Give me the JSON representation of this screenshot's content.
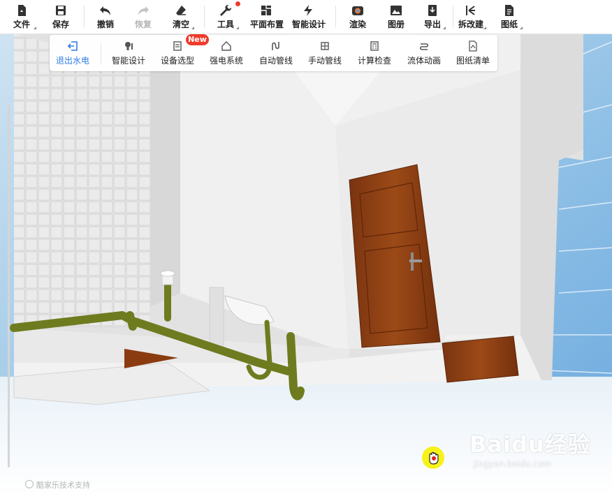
{
  "toolbar": {
    "file": "文件",
    "save": "保存",
    "undo": "撤销",
    "redo": "恢复",
    "clear": "清空",
    "tools": "工具",
    "floor_plan": "平面布置",
    "smart_design": "智能设计",
    "render": "渲染",
    "album": "图册",
    "export": "导出",
    "demolish": "拆改建",
    "drawings": "图纸"
  },
  "subbar": {
    "exit": "退出水电",
    "smart_design": "智能设计",
    "device_select": "设备选型",
    "power_system": "强电系统",
    "auto_pipe": "自动管线",
    "manual_pipe": "手动管线",
    "calc_check": "计算检查",
    "fluid_anim": "流体动画",
    "drawing_list": "图纸清单",
    "new_badge": "New"
  },
  "footer": {
    "support": "酷家乐技术支持"
  },
  "watermark": {
    "brand": "Baidu经验",
    "url": "jingyan.baidu.com"
  },
  "colors": {
    "pipe": "#6f7b1f",
    "door": "#8a3c10",
    "accent": "#2f7ae5",
    "badge": "#ef3b2c"
  }
}
